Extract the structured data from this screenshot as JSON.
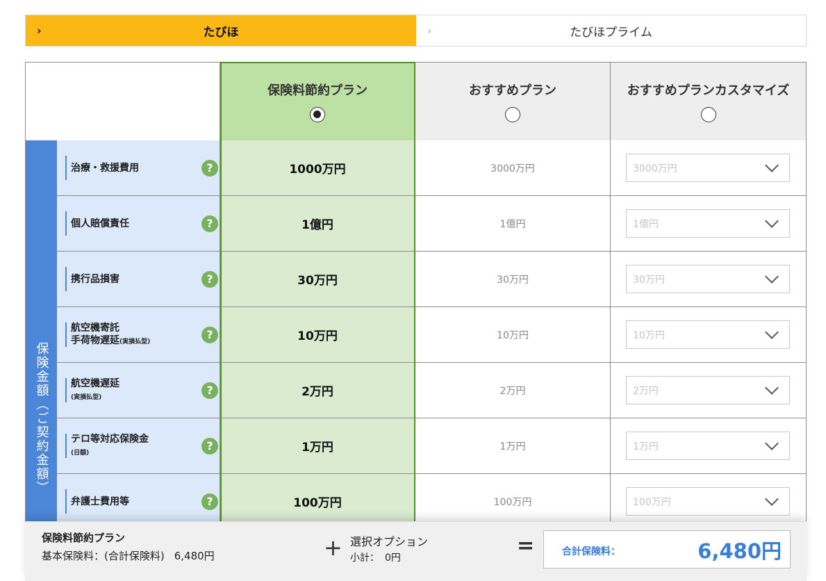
{
  "tabs": [
    {
      "label": "たびほ",
      "active": true
    },
    {
      "label": "たびほプライム",
      "active": false
    }
  ],
  "plans": [
    {
      "label": "保険料節約プラン",
      "selected": true
    },
    {
      "label": "おすすめプラン",
      "selected": false
    },
    {
      "label": "おすすめプランカスタマイズ",
      "selected": false
    }
  ],
  "side_label": "保険金額（ご契約金額）",
  "rows": [
    {
      "label": "治療・救援費用",
      "sub": "",
      "saving": "1000万円",
      "recommended": "3000万円",
      "custom": "3000万円"
    },
    {
      "label": "個人賠償責任",
      "sub": "",
      "saving": "1億円",
      "recommended": "1億円",
      "custom": "1億円"
    },
    {
      "label": "携行品損害",
      "sub": "",
      "saving": "30万円",
      "recommended": "30万円",
      "custom": "30万円"
    },
    {
      "label": "航空機寄託",
      "label2": "手荷物遅延",
      "sub": "(実損払型)",
      "saving": "10万円",
      "recommended": "10万円",
      "custom": "10万円"
    },
    {
      "label": "航空機遅延",
      "sub": "(実損払型)",
      "saving": "2万円",
      "recommended": "2万円",
      "custom": "2万円"
    },
    {
      "label": "テロ等対応保険金",
      "sub": "(日額)",
      "saving": "1万円",
      "recommended": "1万円",
      "custom": "1万円"
    },
    {
      "label": "弁護士費用等",
      "sub": "",
      "saving": "100万円",
      "recommended": "100万円",
      "custom": "100万円"
    }
  ],
  "help_icon": "?",
  "footer": {
    "plan_name": "保険料節約プラン",
    "base_label": "基本保険料：(合計保険料)",
    "base_amount": "6,480円",
    "plus": "+",
    "option_label": "選択オプション",
    "subtotal_label": "小計：",
    "subtotal_amount": "0円",
    "equals": "=",
    "total_label": "合計保険料：",
    "total_amount": "6,480円"
  },
  "colors": {
    "tab_active": "#fbb714",
    "selected_col": "#daebd0",
    "selected_header": "#bde0a4",
    "label_bg": "#dbe9fb",
    "side_bg": "#4b86d9",
    "total_text": "#3b7fd3"
  }
}
